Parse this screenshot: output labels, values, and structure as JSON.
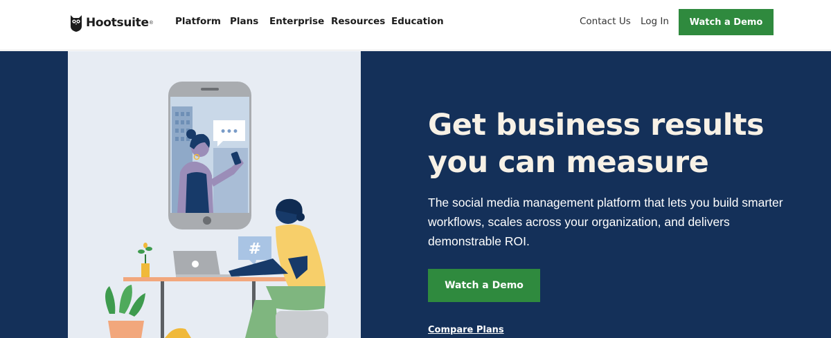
{
  "header": {
    "logo_text": "Hootsuite",
    "logo_mark": "®",
    "nav": [
      {
        "label": "Platform",
        "icon": "none"
      },
      {
        "label": "Plans"
      },
      {
        "label": "Enterprise"
      },
      {
        "label": "Resources"
      },
      {
        "label": "Education"
      }
    ],
    "contact_label": "Contact Us",
    "login_label": "Log In",
    "cta_label": "Watch a Demo"
  },
  "hero": {
    "title": "Get business results you can measure",
    "subtitle": "The social media management platform that lets you build smarter workflows, scales across your organization, and delivers demonstrable ROI.",
    "cta_label": "Watch a Demo",
    "secondary_link": "Compare Plans",
    "illustration_hashtag": "#",
    "illustration_chat": "•••"
  },
  "colors": {
    "header_bg": "#ffffff",
    "hero_bg": "#143059",
    "illustration_bg": "#e7ecf3",
    "cta_green": "#2f8a3e",
    "title_cream": "#f7f1e6",
    "person_shirt": "#f7cf6a",
    "person_pants": "#7fb67f"
  },
  "icons": {
    "logo": "owl-icon",
    "illustration": "person-with-laptop-and-phone-illustration"
  }
}
